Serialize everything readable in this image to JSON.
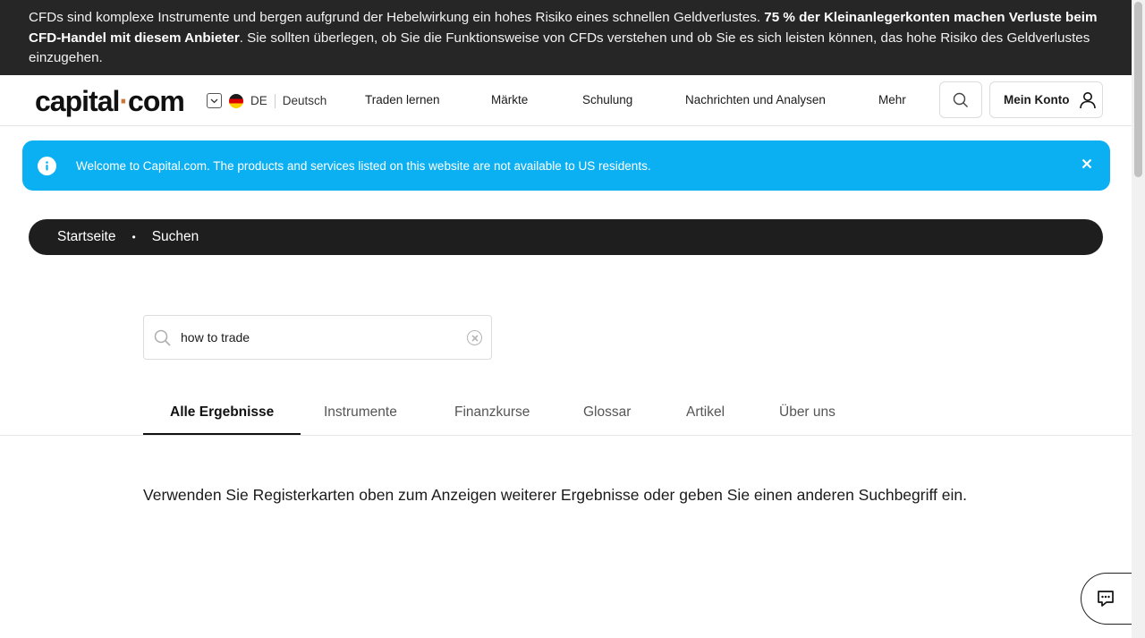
{
  "risk_banner": {
    "text_normal": "CFDs sind komplexe Instrumente und bergen aufgrund der Hebelwirkung ein hohes Risiko eines schnellen Geldverlustes. ",
    "text_bold": "75 % der Kleinanlegerkonten machen Verluste beim CFD-Handel mit diesem Anbieter",
    "text_tail": ". Sie sollten überlegen, ob Sie die Funktionsweise von CFDs verstehen und ob Sie es sich leisten können, das hohe Risiko des Geldverlustes einzugehen."
  },
  "header": {
    "logo_left": "capital",
    "logo_dot": "·",
    "logo_right": "com",
    "lang_code": "DE",
    "lang_name": "Deutsch",
    "nav": [
      "Traden lernen",
      "Märkte",
      "Schulung",
      "Nachrichten und Analysen",
      "Mehr"
    ],
    "account_label": "Mein Konto"
  },
  "info_banner": {
    "message": "Welcome to Capital.com. The products and services listed on this website are not available to US residents."
  },
  "breadcrumb": {
    "home": "Startseite",
    "separator": "•",
    "current": "Suchen"
  },
  "search": {
    "value": "how to trade"
  },
  "tabs": [
    "Alle Ergebnisse",
    "Instrumente",
    "Finanzkurse",
    "Glossar",
    "Artikel",
    "Über uns"
  ],
  "result_message": "Verwenden Sie Registerkarten oben zum Anzeigen weiterer Ergebnisse oder geben Sie einen anderen Suchbegriff ein.",
  "colors": {
    "banner_bg": "#262626",
    "info_bg": "#0bb0f2",
    "breadcrumb_bg": "#1e1e1e",
    "logo_dot": "#c8783c"
  }
}
